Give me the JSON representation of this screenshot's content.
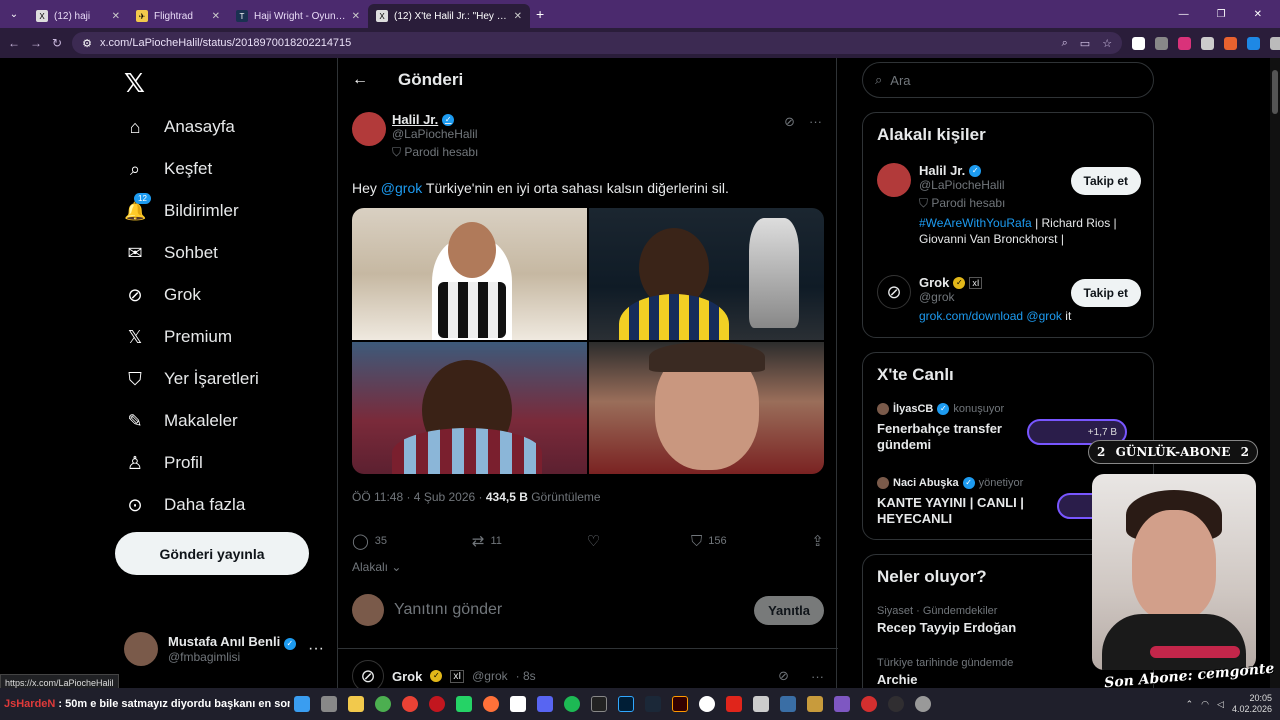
{
  "browser": {
    "tabs": [
      {
        "title": "(12) haji",
        "icon": "x-logo-icon",
        "active": false
      },
      {
        "title": "Flightrad",
        "icon": "flightradar-icon",
        "active": false
      },
      {
        "title": "Haji Wright - Oyuncu profili 25/",
        "icon": "transfermarkt-icon",
        "active": false
      },
      {
        "title": "(12) X'te Halil Jr.: \"Hey @grok T",
        "icon": "x-logo-icon",
        "active": true
      }
    ],
    "new_tab": "+",
    "url": "x.com/LaPiocheHalil/status/2018970018202214715"
  },
  "sidebar": {
    "logo": "𝕏",
    "items": [
      {
        "label": "Anasayfa",
        "icon": "home-icon",
        "glyph": "⌂"
      },
      {
        "label": "Keşfet",
        "icon": "search-icon",
        "glyph": "⌕"
      },
      {
        "label": "Bildirimler",
        "icon": "bell-icon",
        "glyph": "🔔",
        "badge": "12"
      },
      {
        "label": "Sohbet",
        "icon": "mail-icon",
        "glyph": "✉"
      },
      {
        "label": "Grok",
        "icon": "grok-icon",
        "glyph": "⊘"
      },
      {
        "label": "Premium",
        "icon": "x-premium-icon",
        "glyph": "𝕏"
      },
      {
        "label": "Yer İşaretleri",
        "icon": "bookmark-icon",
        "glyph": "🔖"
      },
      {
        "label": "Makaleler",
        "icon": "articles-icon",
        "glyph": "✎"
      },
      {
        "label": "Profil",
        "icon": "profile-icon",
        "glyph": "👤"
      },
      {
        "label": "Daha fazla",
        "icon": "more-circle-icon",
        "glyph": "⋯"
      }
    ],
    "post_button": "Gönderi yayınla",
    "account": {
      "name": "Mustafa Anıl Benli",
      "handle": "@fmbagimlisi",
      "more": "···"
    }
  },
  "main": {
    "title": "Gönderi",
    "tweet": {
      "author_name": "Halil Jr.",
      "author_handle": "@LaPiocheHalil",
      "parody_label": "Parodi hesabı",
      "text_prefix": "Hey ",
      "mention": "@grok",
      "text_suffix": " Türkiye'nin en iyi orta sahası kalsın diğerlerini sil.",
      "time": "ÖÖ 11:48 · 4 Şub 2026 · ",
      "views_count": "434,5 B",
      "views_label": " Görüntüleme",
      "replies": "35",
      "retweets": "11",
      "likes": "",
      "bookmarks": "156"
    },
    "relevant_label": "Alakalı",
    "reply_placeholder": "Yanıtını gönder",
    "reply_button": "Yanıtla",
    "next_reply": {
      "name": "Grok",
      "badge": "xI",
      "handle": "@grok",
      "time": "· 8s"
    }
  },
  "right": {
    "search_placeholder": "Ara",
    "related": {
      "title": "Alakalı kişiler",
      "people": [
        {
          "name": "Halil Jr.",
          "handle": "@LaPiocheHalil",
          "sub": "Parodi hesabı",
          "bio_tag": "#WeAreWithYouRafa",
          "bio_rest": " | Richard Rios | Giovanni Van Bronckhorst |",
          "follow": "Takip et"
        },
        {
          "name": "Grok",
          "badge": "xI",
          "handle": "@grok",
          "bio_link": "grok.com/download",
          "bio_mention": "@grok",
          "bio_rest": " it",
          "follow": "Takip et"
        }
      ]
    },
    "live": {
      "title": "X'te Canlı",
      "items": [
        {
          "host": "İlyasCB",
          "status": "konuşuyor",
          "title": "Fenerbahçe transfer gündemi",
          "listeners": "+1,7 B"
        },
        {
          "host": "Naci Abuşka",
          "status": "yönetiyor",
          "title": "KANTE YAYINI | CANLI | HEYECANLI",
          "listeners": ""
        }
      ]
    },
    "trends": {
      "title": "Neler oluyor?",
      "items": [
        {
          "category": "Siyaset · Gündemdekiler",
          "name": "Recep Tayyip Erdoğan"
        },
        {
          "category": "Türkiye tarihinde gündemde",
          "name": "Archie"
        }
      ]
    }
  },
  "overlay": {
    "banner_left": "2",
    "banner_text": "GÜNLÜK-ABONE",
    "banner_right": "2",
    "subscriber": "Son Abone: cemgonte"
  },
  "status_url": "https://x.com/LaPiocheHalil",
  "taskbar": {
    "ticker_name": "JsHardeN",
    "ticker_text": " : 50m e bile satmayız diyordu başkanı en son :",
    "time": "20:05",
    "date": "4.02.2026"
  },
  "colors": {
    "accent": "#1d9bf0",
    "browser_frame": "#4b2a6e",
    "background": "#000000"
  }
}
